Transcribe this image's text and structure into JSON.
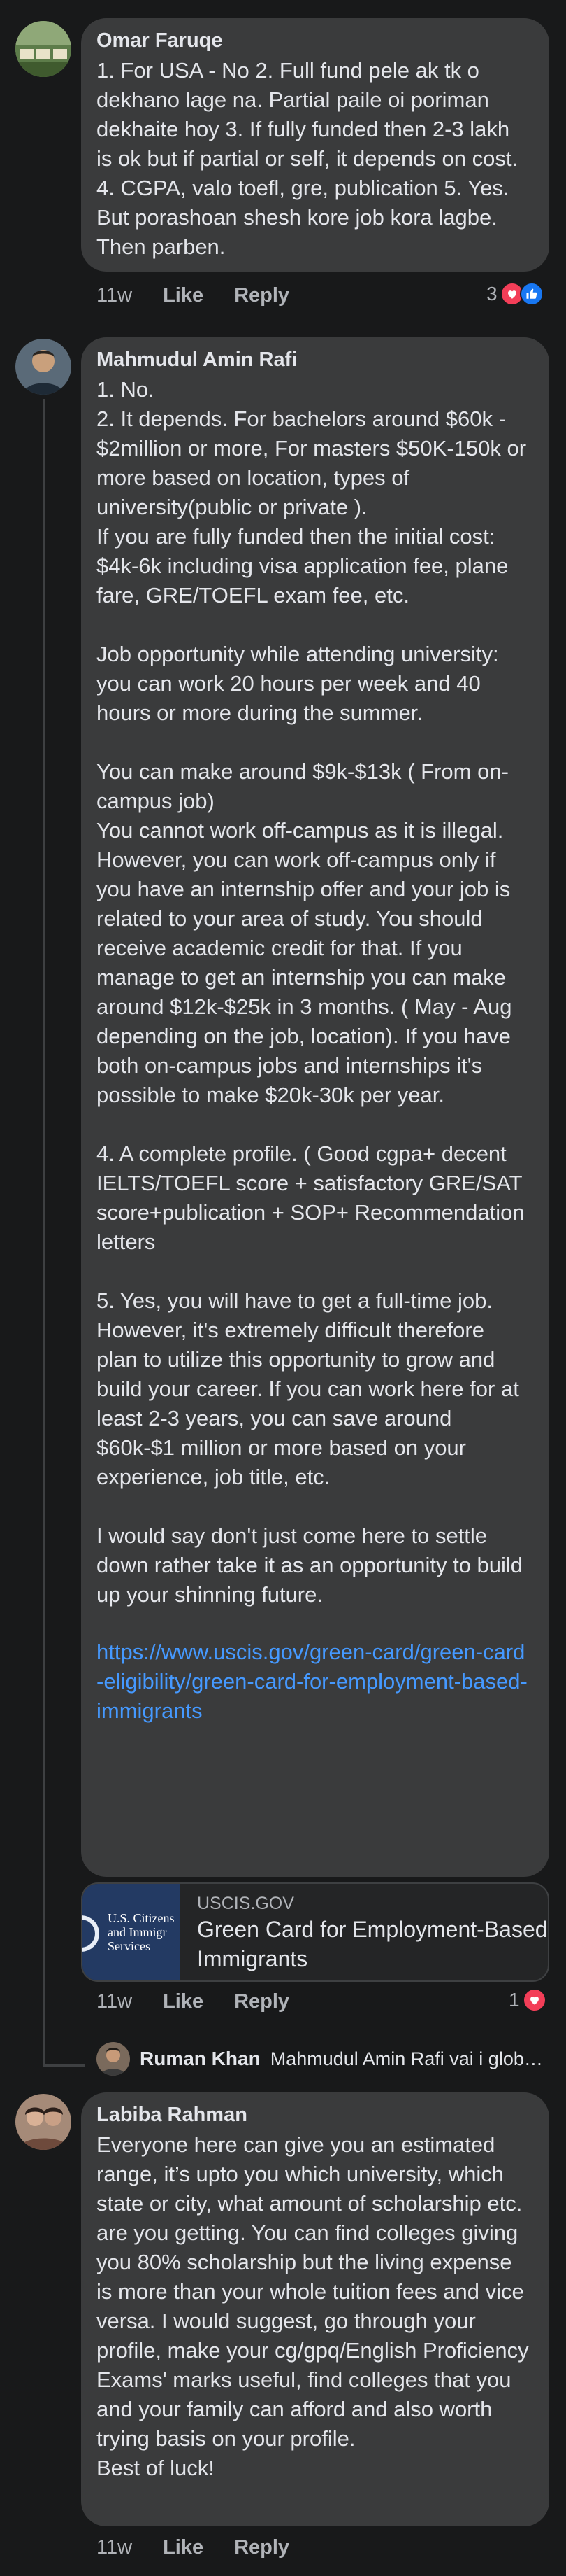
{
  "comments": [
    {
      "author": "Omar Faruqe",
      "text": "1. For USA - No 2. Full fund pele ak tk o dekhano lage na. Partial paile oi poriman dekhaite hoy   3. If fully funded then 2-3 lakh is ok but if partial or self, it depends on cost. 4. CGPA, valo toefl, gre, publication 5. Yes. But porashoan shesh kore job kora lagbe. Then parben.",
      "time": "11w",
      "like": "Like",
      "reply": "Reply",
      "reaction_count": "3"
    },
    {
      "author": "Mahmudul Amin Rafi",
      "text": "1. No.\n2. It depends. For bachelors around $60k - $2million or more, For masters $50K-150k or more based on location, types of university(public or private ).\nIf you are fully funded then the initial cost: $4k-6k including visa application fee, plane fare, GRE/TOEFL exam fee, etc.\n\nJob opportunity while attending university: you can work 20 hours per week and 40 hours or more during the summer.\n\nYou can make around $9k-$13k ( From on-campus job)\nYou cannot work off-campus as it is illegal. However, you can work off-campus only if you have an internship offer and your job is related to your area of study. You should receive academic credit for that. If you manage to get an internship you can make around $12k-$25k in 3 months. ( May - Aug depending on the job, location). If you have both on-campus jobs and internships it's possible to make $20k-30k per year.\n\n4. A complete profile. ( Good cgpa+ decent IELTS/TOEFL score + satisfactory GRE/SAT score+publication + SOP+ Recommendation letters\n\n5. Yes, you will have to get a full-time job. However, it's extremely difficult therefore plan to utilize this opportunity to grow and build your career. If you can work here for at least 2-3 years, you can save around $60k-$1 million or more based on your experience, job title, etc.\n\nI would say don't just come here to settle down rather take it as an opportunity to build up your shinning future.",
      "link": "https://www.uscis.gov/green-card/green-card-eligibility/green-card-for-employment-based-immigrants",
      "card": {
        "thumb_line1": "U.S. Citizens",
        "thumb_line2": "and Immigr",
        "thumb_line3": "Services",
        "domain": "USCIS.GOV",
        "title": "Green Card for Employment-Based Immigrants"
      },
      "time": "11w",
      "like": "Like",
      "reply": "Reply",
      "reaction_count": "1"
    },
    {
      "author": "Labiba Rahman",
      "text": "Everyone here can give you an estimated range, it’s upto you which university, which state or city, what amount of scholarship etc. are you getting. You can find colleges giving you 80% scholarship but the living expense is more than your whole tuition fees and vice versa. I would suggest, go through your profile, make your cg/gpq/English Proficiency Exams' marks useful, find colleges that you and your family can afford and also worth trying basis on your profile.\nBest of luck!",
      "time": "11w",
      "like": "Like",
      "reply": "Reply"
    }
  ],
  "reply_preview": {
    "author": "Ruman Khan",
    "text": "Mahmudul Amin Rafi  vai i glob…"
  },
  "colors": {
    "background": "#18191a",
    "bubble": "#3a3b3c",
    "link": "#4599ff",
    "muted": "#b0b3b8",
    "love": "#f33e58",
    "like": "#1877f2"
  }
}
